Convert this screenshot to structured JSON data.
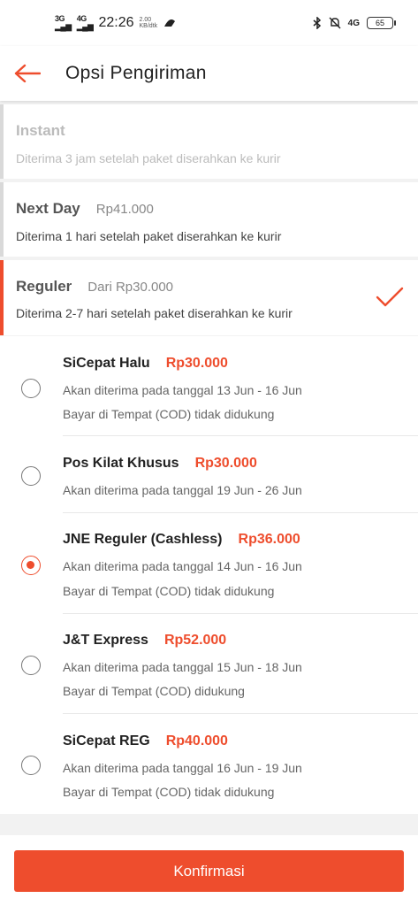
{
  "status_bar": {
    "net1": "3G",
    "net2": "4G",
    "time": "22:26",
    "speed_value": "2.00",
    "speed_unit": "KB/dtk",
    "right_net": "4G",
    "battery": "65"
  },
  "header": {
    "title": "Opsi Pengiriman"
  },
  "services": [
    {
      "name": "Instant",
      "price": "",
      "desc": "Diterima 3 jam setelah paket diserahkan ke kurir"
    },
    {
      "name": "Next Day",
      "price": "Rp41.000",
      "desc": "Diterima 1 hari setelah paket diserahkan ke kurir"
    },
    {
      "name": "Reguler",
      "price": "Dari Rp30.000",
      "desc": "Diterima 2-7 hari setelah paket diserahkan ke kurir"
    }
  ],
  "couriers": [
    {
      "name": "SiCepat Halu",
      "price": "Rp30.000",
      "eta": "Akan diterima pada tanggal 13 Jun - 16 Jun",
      "cod": "Bayar di Tempat (COD) tidak didukung"
    },
    {
      "name": "Pos Kilat Khusus",
      "price": "Rp30.000",
      "eta": "Akan diterima pada tanggal 19 Jun - 26 Jun",
      "cod": ""
    },
    {
      "name": "JNE Reguler (Cashless)",
      "price": "Rp36.000",
      "eta": "Akan diterima pada tanggal 14 Jun - 16 Jun",
      "cod": "Bayar di Tempat (COD) tidak didukung"
    },
    {
      "name": "J&T Express",
      "price": "Rp52.000",
      "eta": "Akan diterima pada tanggal 15 Jun - 18 Jun",
      "cod": "Bayar di Tempat (COD) didukung"
    },
    {
      "name": "SiCepat REG",
      "price": "Rp40.000",
      "eta": "Akan diterima pada tanggal 16 Jun - 19 Jun",
      "cod": "Bayar di Tempat (COD) tidak didukung"
    }
  ],
  "selected_courier_index": 2,
  "footer": {
    "confirm_label": "Konfirmasi"
  },
  "colors": {
    "accent": "#ee4d2d",
    "inactive_bar": "#d9d9d9"
  },
  "icons": {
    "back": "arrow-left-icon",
    "selected": "checkmark-icon",
    "bluetooth": "bluetooth-icon",
    "mute": "bell-off-icon"
  }
}
